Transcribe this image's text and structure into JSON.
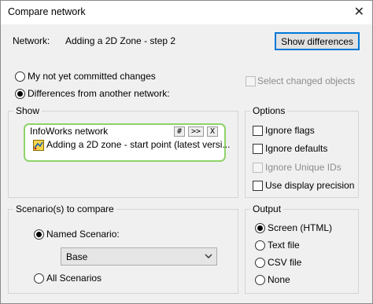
{
  "window": {
    "title": "Compare network",
    "close_glyph": "✕"
  },
  "network": {
    "label": "Network:",
    "value": "Adding a 2D Zone - step 2",
    "show_differences_label": "Show differences"
  },
  "compare_mode": {
    "options": [
      {
        "label": "My not yet committed changes",
        "selected": false
      },
      {
        "label": "Differences from another network:",
        "selected": true
      }
    ],
    "select_changed_objects": {
      "label": "Select changed objects",
      "checked": false,
      "enabled": false
    }
  },
  "show": {
    "legend": "Show",
    "network_box": {
      "header": "InfoWorks network",
      "buttons": [
        "#",
        ">>",
        "X"
      ],
      "item_icon": "network-model-icon",
      "item_text": "Adding a 2D zone - start point (latest versi..."
    }
  },
  "options": {
    "legend": "Options",
    "items": [
      {
        "label": "Ignore flags",
        "checked": false,
        "enabled": true
      },
      {
        "label": "Ignore defaults",
        "checked": false,
        "enabled": true
      },
      {
        "label": "Ignore Unique IDs",
        "checked": false,
        "enabled": false
      },
      {
        "label": "Use display precision",
        "checked": false,
        "enabled": true
      }
    ]
  },
  "scenarios": {
    "legend": "Scenario(s) to compare",
    "named_label": "Named Scenario:",
    "named_selected": true,
    "dropdown_value": "Base",
    "all_label": "All Scenarios",
    "all_selected": false
  },
  "output": {
    "legend": "Output",
    "items": [
      {
        "label": "Screen (HTML)",
        "selected": true
      },
      {
        "label": "Text file",
        "selected": false
      },
      {
        "label": "CSV file",
        "selected": false
      },
      {
        "label": "None",
        "selected": false
      }
    ]
  },
  "colors": {
    "highlight_border": "#8ed36a",
    "dialog_bg": "#f0f0f0",
    "button_bg": "#e1e1e1",
    "accent_border": "#0078d7"
  }
}
